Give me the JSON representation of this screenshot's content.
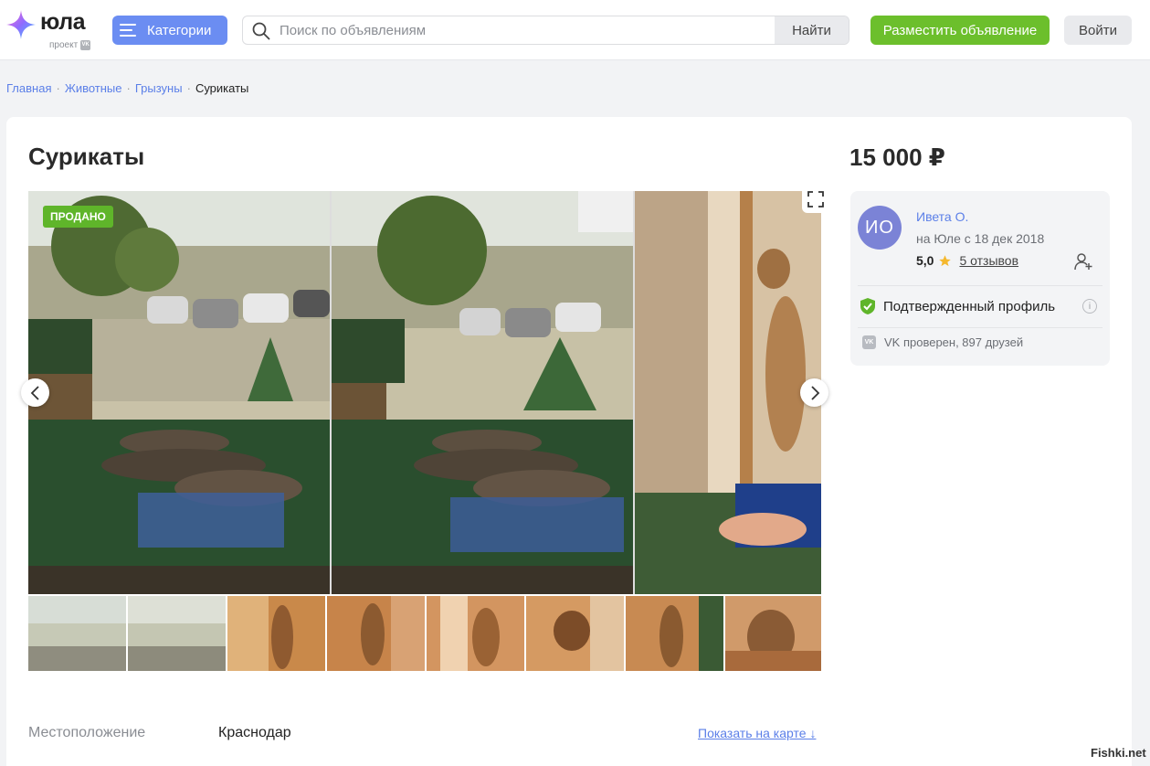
{
  "header": {
    "logo_text": "юла",
    "logo_sub": "проект",
    "logo_vk": "VK",
    "categories_label": "Категории",
    "search_placeholder": "Поиск по объявлениям",
    "search_button": "Найти",
    "post_button": "Разместить объявление",
    "login_button": "Войти"
  },
  "breadcrumb": [
    "Главная",
    "Животные",
    "Грызуны",
    "Сурикаты"
  ],
  "listing": {
    "title": "Сурикаты",
    "status_badge": "ПРОДАНО",
    "price": "15 000 ₽",
    "location_label": "Местоположение",
    "location_value": "Краснодар",
    "map_link": "Показать на карте ↓",
    "thumbnail_count": 8
  },
  "seller": {
    "initials": "ИО",
    "name": "Ивета О.",
    "since": "на Юле с 18 дек 2018",
    "rating": "5,0",
    "reviews": "5 отзывов",
    "verified_label": "Подтвержденный профиль",
    "vk_badge": "VK",
    "vk_status": "VK проверен, 897 друзей"
  },
  "watermark": "Fishki.net",
  "colors": {
    "accent_blue": "#6b8df2",
    "link_blue": "#5b7fe8",
    "green": "#6cbf2c",
    "avatar": "#7b83d6"
  }
}
